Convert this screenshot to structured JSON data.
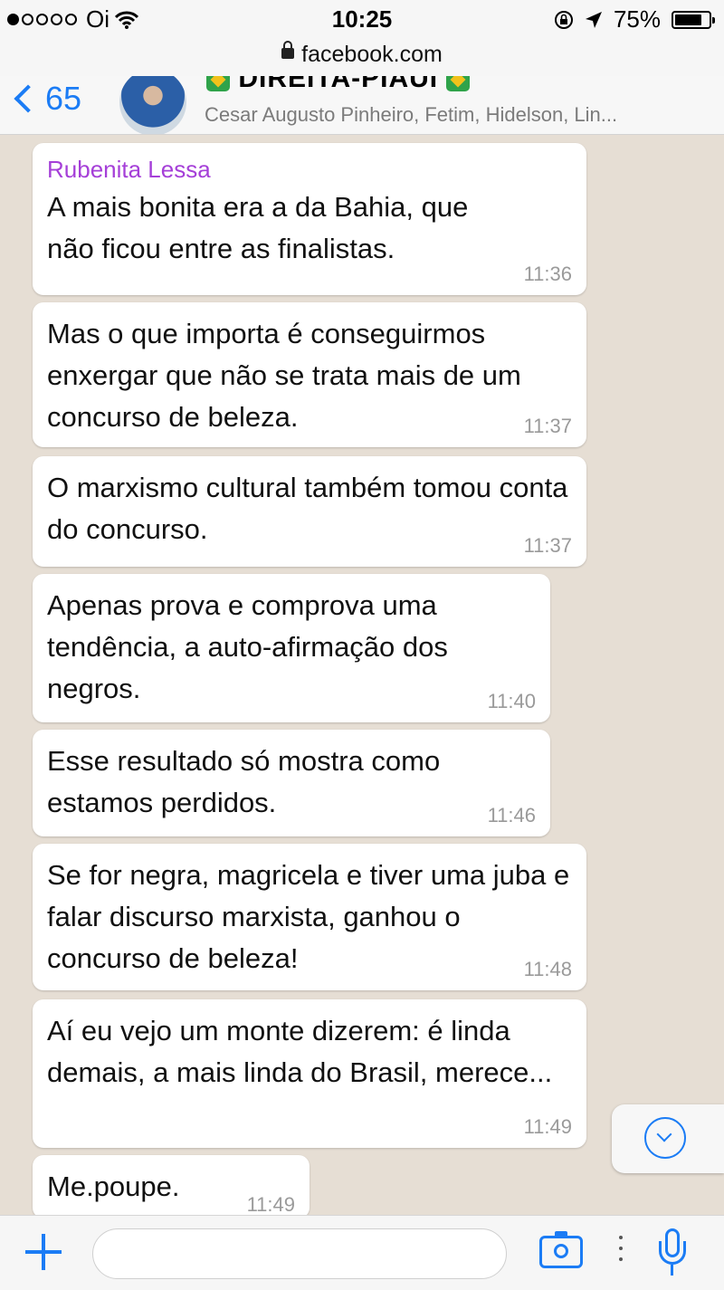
{
  "status_bar": {
    "carrier": "Oi",
    "time": "10:25",
    "battery": "75%"
  },
  "url_bar": {
    "url": "facebook.com"
  },
  "chat_header": {
    "back_count": "65",
    "group_title": "DIREITA-PIAUI",
    "participants": "Cesar Augusto Pinheiro, Fetim, Hidelson, Lin..."
  },
  "messages": [
    {
      "sender": "Rubenita Lessa",
      "text": "A mais bonita era a da Bahia, que não ficou entre as finalistas.",
      "time": "11:36"
    },
    {
      "text": "Mas o que importa é conseguirmos enxergar que não se trata mais de um concurso de beleza.",
      "time": "11:37"
    },
    {
      "text": "O marxismo cultural também tomou conta do concurso.",
      "time": "11:37"
    },
    {
      "text": "Apenas prova e comprova uma tendência, a auto-afirmação dos negros.",
      "time": "11:40"
    },
    {
      "text": "Esse resultado só mostra como estamos perdidos.",
      "time": "11:46"
    },
    {
      "text": "Se for negra, magricela e tiver uma juba e falar discurso marxista, ganhou o concurso de beleza!",
      "time": "11:48"
    },
    {
      "text": "Aí eu vejo um monte dizerem: é linda demais, a mais linda do Brasil, merece...",
      "time": "11:49"
    },
    {
      "text": "Me.poupe.",
      "time": "11:49"
    }
  ],
  "icons": {
    "back": "chevron-left-icon",
    "scroll_down": "chevron-down-circle-icon",
    "attach": "plus-icon",
    "camera": "camera-icon",
    "microphone": "microphone-icon"
  },
  "colors": {
    "accent": "#1b7cf5",
    "sender_name": "#a53fd8",
    "chat_background": "#e6ded4",
    "bubble": "#ffffff"
  }
}
